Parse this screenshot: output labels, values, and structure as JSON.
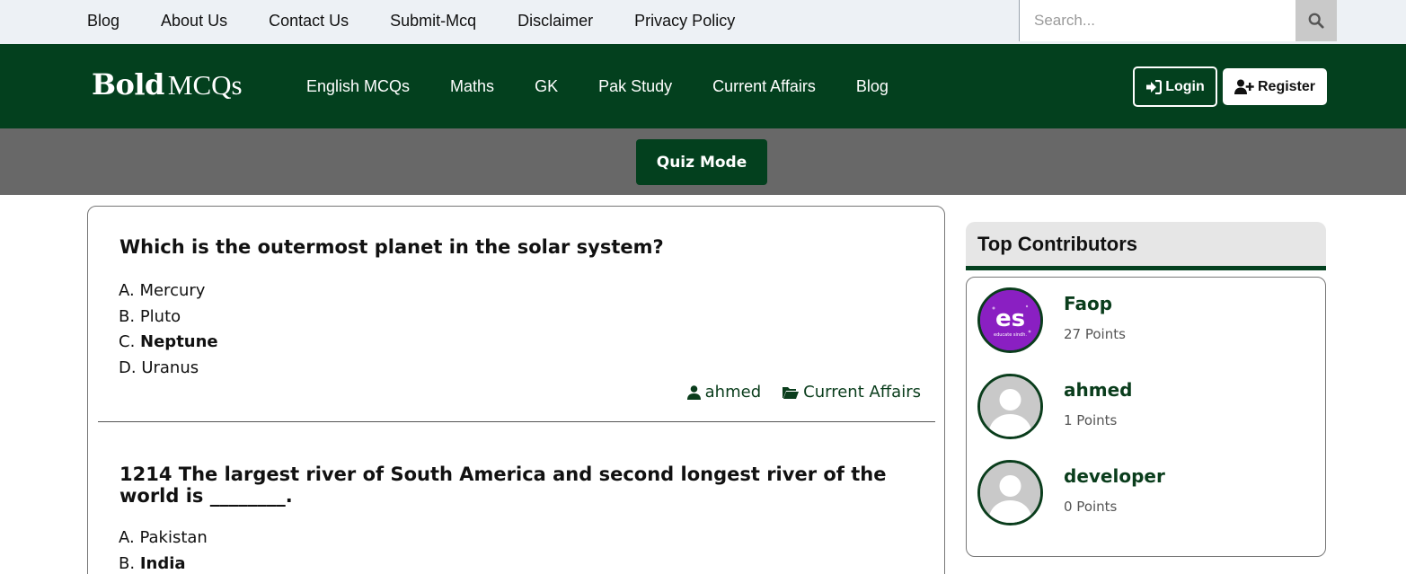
{
  "topbar": {
    "links": [
      "Blog",
      "About Us",
      "Contact Us",
      "Submit-Mcq",
      "Disclaimer",
      "Privacy Policy"
    ],
    "search": {
      "placeholder": "Search...",
      "value": "",
      "icon": "search-icon"
    }
  },
  "header": {
    "logo_bold": "Bold",
    "logo_light": "MCQs",
    "nav": [
      "English MCQs",
      "Maths",
      "GK",
      "Pak Study",
      "Current Affairs",
      "Blog"
    ],
    "login_label": "Login",
    "register_label": "Register",
    "colors": {
      "brand_green": "#03401e",
      "topbar_bg": "#edf1f5",
      "quiz_band": "#686868"
    }
  },
  "quiz_mode_label": "Quiz Mode",
  "questions": [
    {
      "title": "Which is the outermost planet in the solar system?",
      "options": [
        {
          "letter": "A.",
          "text": "Mercury"
        },
        {
          "letter": "B.",
          "text": "Pluto"
        },
        {
          "letter": "C.",
          "text": "Neptune"
        },
        {
          "letter": "D.",
          "text": "Uranus"
        }
      ],
      "correct_letter": "C.",
      "author": "ahmed",
      "category": "Current Affairs"
    },
    {
      "title": "1214 The largest river of South America and second longest river of the world is ________.",
      "options": [
        {
          "letter": "A.",
          "text": "Pakistan"
        },
        {
          "letter": "B.",
          "text": "India"
        }
      ],
      "correct_letter": "B."
    }
  ],
  "sidebar": {
    "title": "Top Contributors",
    "contributors": [
      {
        "name": "Faop",
        "points": "27 Points",
        "avatar_text": "es",
        "avatar_subtext": "educate sindh."
      },
      {
        "name": "ahmed",
        "points": "1 Points"
      },
      {
        "name": "developer",
        "points": "0 Points"
      }
    ]
  }
}
